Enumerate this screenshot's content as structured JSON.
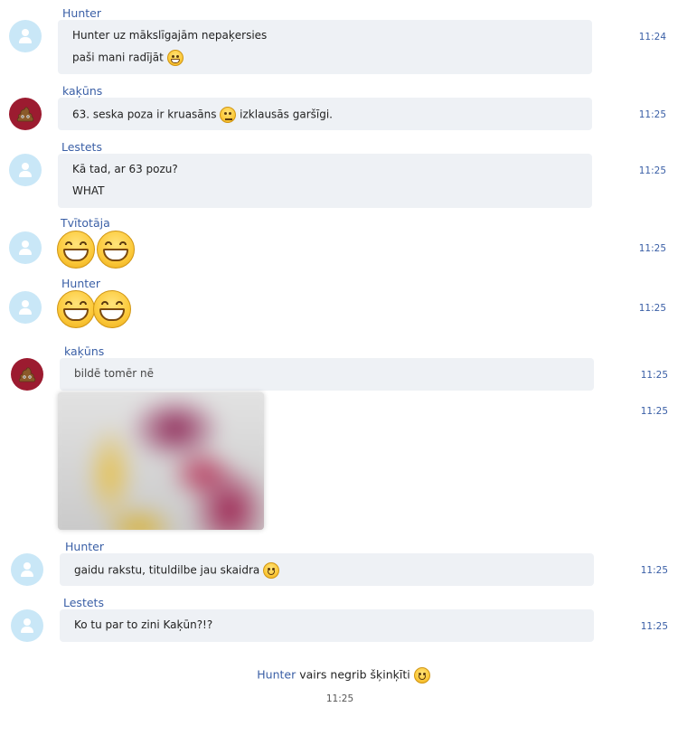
{
  "messages": [
    {
      "sender": "Hunter",
      "lines": [
        "Hunter uz mākslīgajām nepaķersies",
        "paši mani radījāt"
      ],
      "time": "11:24",
      "emoji": "grin-emoji"
    },
    {
      "sender": "kaķūns",
      "text_before": "63. seska poza ir kruasāns",
      "text_after": "izklausās garšīgi.",
      "time": "11:25",
      "emoji": "confused-emoji"
    },
    {
      "sender": "Lestets",
      "lines": [
        "Kā tad, ar 63 pozu?",
        "WHAT"
      ],
      "time": "11:25"
    },
    {
      "sender": "Tvītotāja",
      "time": "11:25",
      "emoji": "grin-emoji x2"
    },
    {
      "sender": "Hunter",
      "time": "11:25",
      "emoji": "grin-emoji x2"
    },
    {
      "sender": "kaķūns",
      "text": "bildē tomēr nē",
      "time": "11:25",
      "image_time": "11:25"
    },
    {
      "sender": "Hunter",
      "text": "gaidu rakstu, tituldilbe jau skaidra",
      "time": "11:25",
      "emoji": "smile-emoji"
    },
    {
      "sender": "Lestets",
      "text": "Ko tu par to zini Kaķūn?!?",
      "time": "11:25"
    }
  ],
  "notice": {
    "who": "Hunter",
    "text": "vairs negrib šķinķīti",
    "time": "11:25",
    "emoji": "smile-emoji"
  },
  "colors": {
    "accent": "#3a5fa6",
    "bubble": "#eef1f5",
    "avatar_default": "#c9e7f7",
    "avatar_poop": "#9c1b30"
  }
}
